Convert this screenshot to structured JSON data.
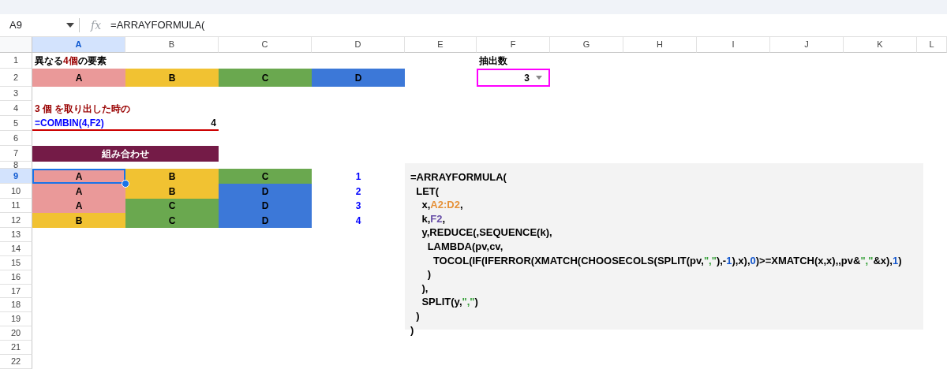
{
  "formula_bar": {
    "name_box": "A9",
    "function_icon": "fx",
    "formula": "=ARRAYFORMULA("
  },
  "columns": [
    {
      "label": "A",
      "selected": true
    },
    {
      "label": "B",
      "selected": false
    },
    {
      "label": "C",
      "selected": false
    },
    {
      "label": "D",
      "selected": false
    },
    {
      "label": "E",
      "selected": false
    },
    {
      "label": "F",
      "selected": false
    },
    {
      "label": "G",
      "selected": false
    },
    {
      "label": "H",
      "selected": false
    },
    {
      "label": "I",
      "selected": false
    },
    {
      "label": "J",
      "selected": false
    },
    {
      "label": "K",
      "selected": false
    },
    {
      "label": "L",
      "selected": false
    }
  ],
  "rows": [
    {
      "number": "1",
      "selected": false,
      "cells": [
        {
          "parts": [
            {
              "text": "異なる ",
              "kind": "plain"
            },
            {
              "text": "4個",
              "kind": "emphasis"
            },
            {
              "text": " の要素",
              "kind": "plain"
            }
          ]
        },
        {},
        {},
        {},
        {},
        {
          "text": "抽出数"
        }
      ]
    },
    {
      "number": "2",
      "selected": false,
      "cells": [
        {
          "text": "A",
          "color": "#ea9999",
          "centered": true
        },
        {
          "text": "B",
          "color": "#f1c232",
          "centered": true
        },
        {
          "text": "C",
          "color": "#6aa84f",
          "centered": true
        },
        {
          "text": "D",
          "color": "#3c78d8",
          "centered": true
        },
        {},
        {
          "text": "3",
          "kind": "dropdown",
          "right_aligned": true,
          "highlighted": true
        }
      ]
    },
    {
      "number": "3",
      "selected": false
    },
    {
      "number": "4",
      "selected": false,
      "cells": [
        {
          "text": "3 個 を取り出した時の",
          "kind": "emphasis",
          "merge_right": true
        },
        {}
      ]
    },
    {
      "number": "5",
      "selected": false,
      "cells": [
        {
          "text": "=COMBIN(4,F2)",
          "kind": "formula",
          "rule_below": true
        },
        {
          "text": "4",
          "right_aligned": true,
          "rule_below": true
        }
      ]
    },
    {
      "number": "6",
      "selected": false
    },
    {
      "number": "7",
      "selected": false,
      "cells": [
        {
          "text": "組み合わせ",
          "kind": "heading",
          "color": "#741b47",
          "centered": true,
          "merge_right": true
        },
        {}
      ]
    },
    {
      "number": "8",
      "selected": false
    },
    {
      "number": "9",
      "selected": true,
      "cells": [
        {
          "text": "A",
          "color": "#ea9999",
          "centered": true,
          "selected": true
        },
        {
          "text": "B",
          "color": "#f1c232",
          "centered": true
        },
        {
          "text": "C",
          "color": "#6aa84f",
          "centered": true
        },
        {
          "text": "1",
          "kind": "formula",
          "centered": true
        }
      ]
    },
    {
      "number": "10",
      "selected": false,
      "cells": [
        {
          "text": "A",
          "color": "#ea9999",
          "centered": true
        },
        {
          "text": "B",
          "color": "#f1c232",
          "centered": true
        },
        {
          "text": "D",
          "color": "#3c78d8",
          "centered": true
        },
        {
          "text": "2",
          "kind": "formula",
          "centered": true
        }
      ]
    },
    {
      "number": "11",
      "selected": false,
      "cells": [
        {
          "text": "A",
          "color": "#ea9999",
          "centered": true
        },
        {
          "text": "C",
          "color": "#6aa84f",
          "centered": true
        },
        {
          "text": "D",
          "color": "#3c78d8",
          "centered": true
        },
        {
          "text": "3",
          "kind": "formula",
          "centered": true
        }
      ]
    },
    {
      "number": "12",
      "selected": false,
      "cells": [
        {
          "text": "B",
          "color": "#f1c232",
          "centered": true
        },
        {
          "text": "C",
          "color": "#6aa84f",
          "centered": true
        },
        {
          "text": "D",
          "color": "#3c78d8",
          "centered": true
        },
        {
          "text": "4",
          "kind": "formula",
          "centered": true
        }
      ]
    },
    {
      "number": "13",
      "selected": false
    },
    {
      "number": "14",
      "selected": false
    },
    {
      "number": "15",
      "selected": false
    },
    {
      "number": "16",
      "selected": false
    },
    {
      "number": "17",
      "selected": false
    },
    {
      "number": "18",
      "selected": false
    },
    {
      "number": "19",
      "selected": false
    },
    {
      "number": "20",
      "selected": false
    },
    {
      "number": "21",
      "selected": false
    },
    {
      "number": "22",
      "selected": false
    }
  ],
  "code_panel": {
    "lines": [
      [
        {
          "text": "=ARRAYFORMULA(",
          "kind": "plain"
        }
      ],
      [
        {
          "text": "  LET(",
          "kind": "plain"
        }
      ],
      [
        {
          "text": "    x,",
          "kind": "plain"
        },
        {
          "text": "A2:D2",
          "kind": "range"
        },
        {
          "text": ",",
          "kind": "plain"
        }
      ],
      [
        {
          "text": "    k,",
          "kind": "plain"
        },
        {
          "text": "F2",
          "kind": "reference"
        },
        {
          "text": ",",
          "kind": "plain"
        }
      ],
      [
        {
          "text": "    y,REDUCE(,SEQUENCE(k),",
          "kind": "plain"
        }
      ],
      [
        {
          "text": "      LAMBDA(pv,cv,",
          "kind": "plain"
        }
      ],
      [
        {
          "text": "        TOCOL(IF(IFERROR(XMATCH(CHOOSECOLS(SPLIT(pv,",
          "kind": "plain"
        },
        {
          "text": "\",\"",
          "kind": "string"
        },
        {
          "text": "),-",
          "kind": "plain"
        },
        {
          "text": "1",
          "kind": "number"
        },
        {
          "text": "),x),",
          "kind": "plain"
        },
        {
          "text": "0",
          "kind": "number"
        },
        {
          "text": ")>=XMATCH(x,x),,pv&",
          "kind": "plain"
        },
        {
          "text": "\",\"",
          "kind": "string"
        },
        {
          "text": "&x),",
          "kind": "plain"
        },
        {
          "text": "1",
          "kind": "number"
        },
        {
          "text": ")",
          "kind": "plain"
        }
      ],
      [
        {
          "text": "      )",
          "kind": "plain"
        }
      ],
      [
        {
          "text": "    ),",
          "kind": "plain"
        }
      ],
      [
        {
          "text": "    SPLIT(y,",
          "kind": "plain"
        },
        {
          "text": "\",\"",
          "kind": "string"
        },
        {
          "text": ")",
          "kind": "plain"
        }
      ],
      [
        {
          "text": "  )",
          "kind": "plain"
        }
      ],
      [
        {
          "text": ")",
          "kind": "plain"
        }
      ]
    ]
  }
}
